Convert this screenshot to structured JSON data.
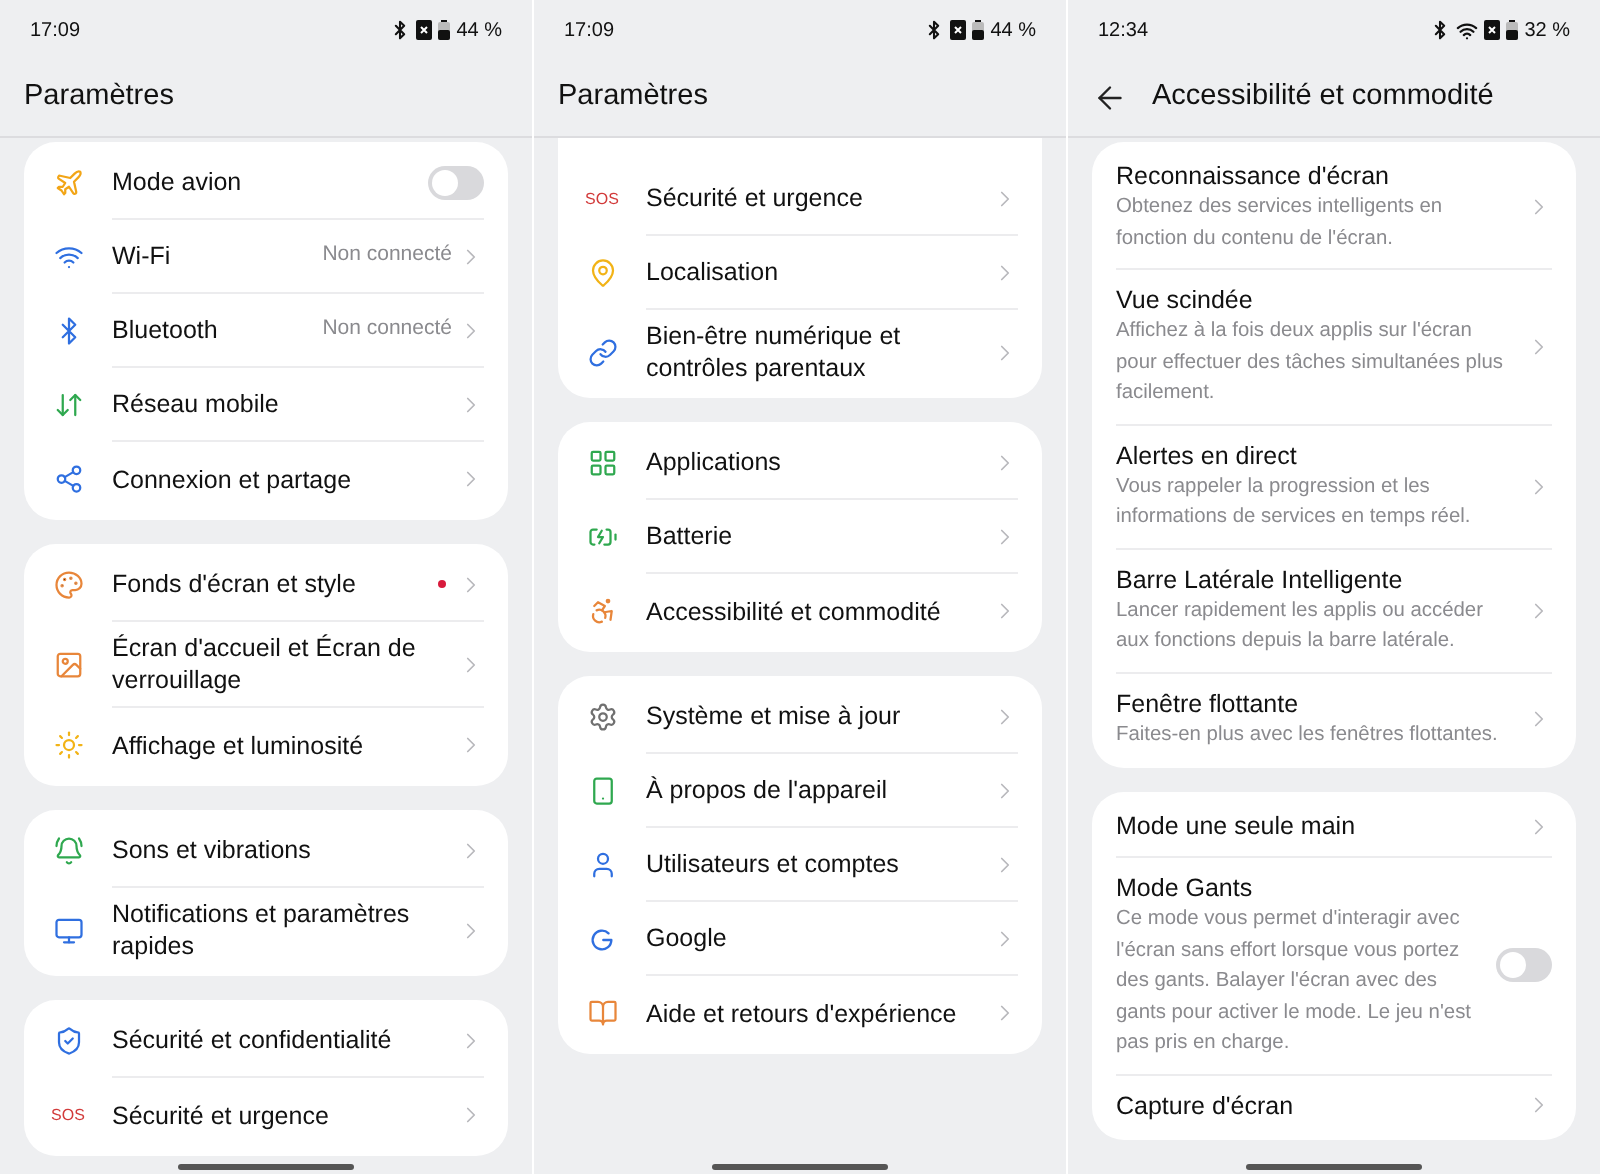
{
  "panels": [
    {
      "status_bar": {
        "time": "17:09",
        "battery": "44 %",
        "wifi": false
      },
      "header": {
        "title": "Paramètres",
        "back": false
      },
      "sections": [
        {
          "cut_top": false,
          "items": [
            {
              "kind": "toggle",
              "label": "Mode avion",
              "on": false
            },
            {
              "kind": "nav",
              "label": "Wi-Fi",
              "value": "Non connecté"
            },
            {
              "kind": "nav",
              "label": "Bluetooth",
              "value": "Non connecté"
            },
            {
              "kind": "nav",
              "label": "Réseau mobile"
            },
            {
              "kind": "nav",
              "label": "Connexion et partage"
            }
          ]
        },
        {
          "cut_top": false,
          "items": [
            {
              "kind": "nav",
              "label": "Fonds d'écran et style",
              "dot": true
            },
            {
              "kind": "nav",
              "label": "Écran d'accueil et Écran de verrouillage"
            },
            {
              "kind": "nav",
              "label": "Affichage et luminosité"
            }
          ]
        },
        {
          "cut_top": false,
          "items": [
            {
              "kind": "nav",
              "label": "Sons et vibrations"
            },
            {
              "kind": "nav",
              "label": "Notifications et paramètres rapides"
            }
          ]
        },
        {
          "cut_top": false,
          "items": [
            {
              "kind": "nav",
              "label": "Sécurité et confidentialité"
            },
            {
              "kind": "nav",
              "label": "Sécurité et urgence",
              "icon_text": "SOS"
            }
          ]
        }
      ]
    },
    {
      "status_bar": {
        "time": "17:09",
        "battery": "44 %",
        "wifi": false
      },
      "header": {
        "title": "Paramètres",
        "back": false
      },
      "sections": [
        {
          "cut_top": true,
          "items": [
            {
              "kind": "nav",
              "label": "Sécurité et urgence",
              "icon_text": "SOS"
            },
            {
              "kind": "nav",
              "label": "Localisation"
            },
            {
              "kind": "nav",
              "label": "Bien-être numérique et contrôles parentaux"
            }
          ]
        },
        {
          "cut_top": false,
          "items": [
            {
              "kind": "nav",
              "label": "Applications"
            },
            {
              "kind": "nav",
              "label": "Batterie"
            },
            {
              "kind": "nav",
              "label": "Accessibilité et commodité"
            }
          ]
        },
        {
          "cut_top": false,
          "items": [
            {
              "kind": "nav",
              "label": "Système et mise à jour"
            },
            {
              "kind": "nav",
              "label": "À propos de l'appareil"
            },
            {
              "kind": "nav",
              "label": "Utilisateurs et comptes"
            },
            {
              "kind": "nav",
              "label": "Google"
            },
            {
              "kind": "nav",
              "label": "Aide et retours d'expérience"
            }
          ]
        }
      ]
    },
    {
      "status_bar": {
        "time": "12:34",
        "battery": "32 %",
        "wifi": true
      },
      "header": {
        "title": "Accessibilité et commodité",
        "back": true
      },
      "sections": [
        {
          "cut_top": false,
          "items": [
            {
              "kind": "nav",
              "label": "Reconnaissance d'écran",
              "description": "Obtenez des services intelligents en fonction du contenu de l'écran."
            },
            {
              "kind": "nav",
              "label": "Vue scindée",
              "description": "Affichez à la fois deux applis sur l'écran pour effectuer des tâches simultanées plus facilement."
            },
            {
              "kind": "nav",
              "label": "Alertes en direct",
              "description": "Vous rappeler la progression et les informations de services en temps réel."
            },
            {
              "kind": "nav",
              "label": "Barre Latérale Intelligente",
              "description": "Lancer rapidement les applis ou accéder aux fonctions depuis la barre latérale."
            },
            {
              "kind": "nav",
              "label": "Fenêtre flottante",
              "description": "Faites-en plus avec les fenêtres flottantes."
            }
          ]
        },
        {
          "cut_top": false,
          "items": [
            {
              "kind": "nav",
              "label": "Mode une seule main"
            },
            {
              "kind": "toggle",
              "label": "Mode Gants",
              "on": false,
              "description": "Ce mode vous permet d'interagir avec l'écran sans effort lorsque vous portez des gants. Balayer l'écran avec des gants pour activer le mode. Le jeu n'est pas pris en charge."
            },
            {
              "kind": "nav",
              "label": "Capture d'écran"
            }
          ]
        }
      ]
    }
  ]
}
